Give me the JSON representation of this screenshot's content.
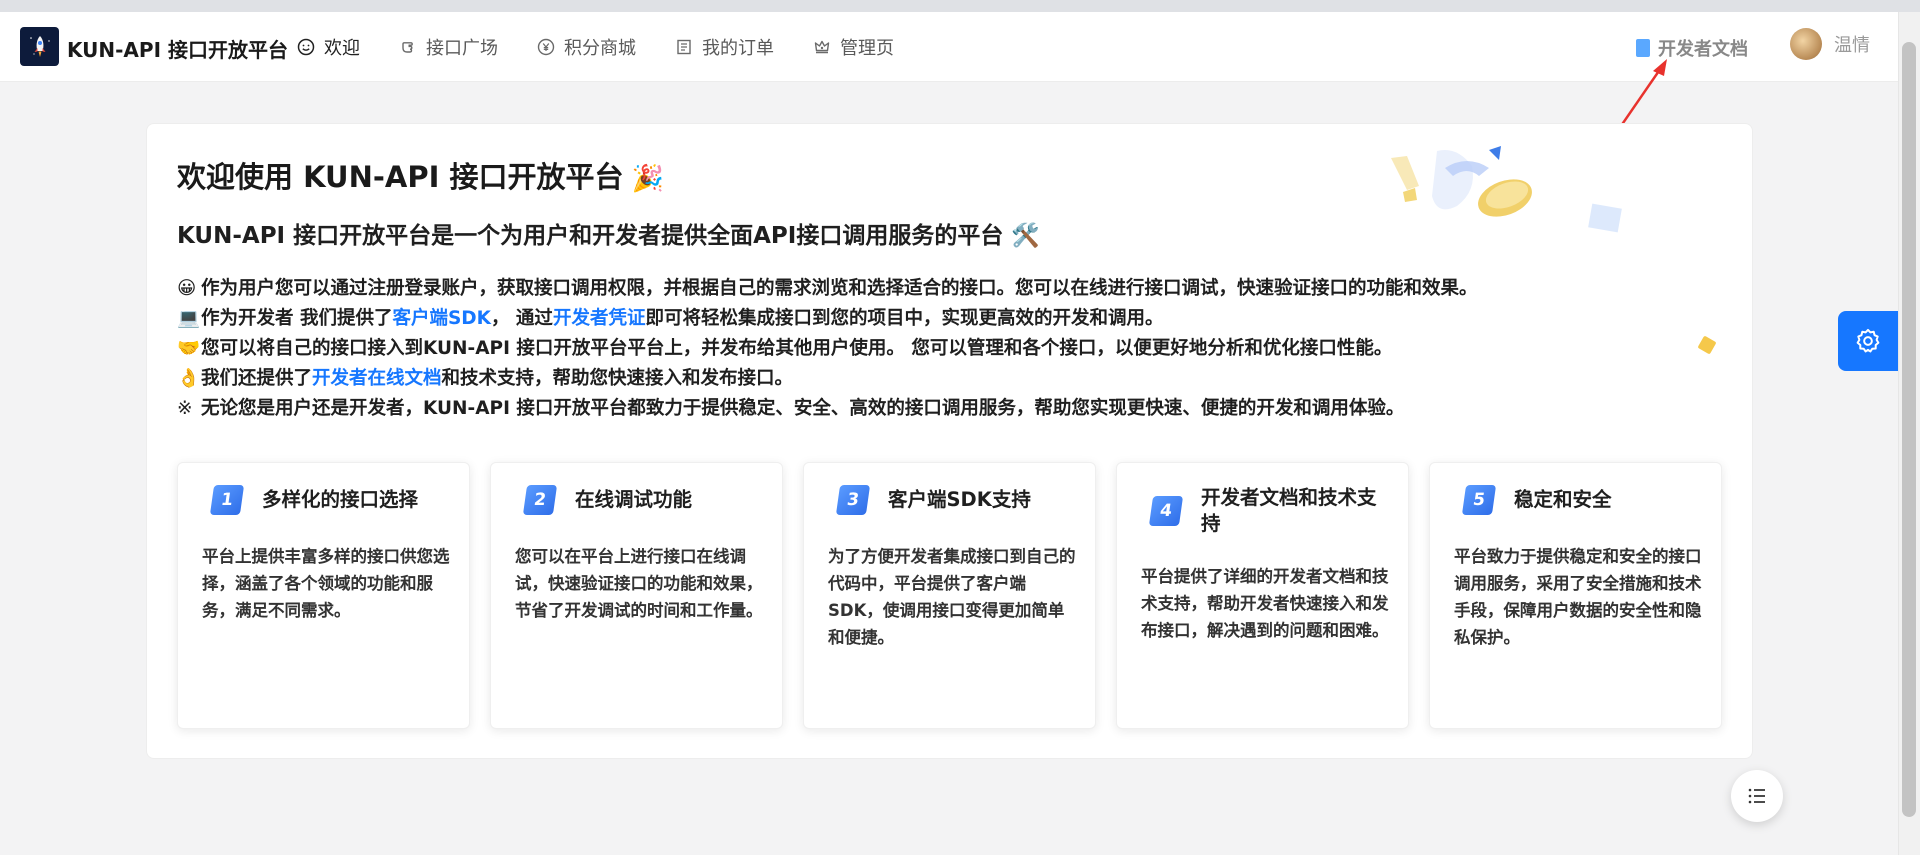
{
  "app": {
    "title": "KUN-API 接口开放平台"
  },
  "nav": [
    {
      "label": "欢迎",
      "icon": "smile-icon",
      "active": true
    },
    {
      "label": "接口广场",
      "icon": "hand-icon",
      "active": false
    },
    {
      "label": "积分商城",
      "icon": "yen-icon",
      "active": false
    },
    {
      "label": "我的订单",
      "icon": "order-list-icon",
      "active": false
    },
    {
      "label": "管理页",
      "icon": "crown-icon",
      "active": false
    }
  ],
  "header": {
    "docs_label": "开发者文档",
    "user_name": "温情"
  },
  "welcome": {
    "title": "欢迎使用 KUN-API 接口开放平台",
    "title_emoji": "🎉",
    "subtitle": "KUN-API 接口开放平台是一个为用户和开发者提供全面API接口调用服务的平台",
    "subtitle_emoji": "🛠️"
  },
  "descriptions": [
    {
      "emoji": "😀",
      "text": "作为用户您可以通过注册登录账户，获取接口调用权限，并根据自己的需求浏览和选择适合的接口。您可以在线进行接口调试，快速验证接口的功能和效果。"
    },
    {
      "emoji": "💻",
      "pre": "作为开发者 我们提供了",
      "link1": "客户端SDK",
      "mid": "， 通过",
      "link2": "开发者凭证",
      "post": "即可将轻松集成接口到您的项目中，实现更高效的开发和调用。"
    },
    {
      "emoji": "🤝",
      "text": "您可以将自己的接口接入到KUN-API 接口开放平台平台上，并发布给其他用户使用。 您可以管理和各个接口，以便更好地分析和优化接口性能。"
    },
    {
      "emoji": "👌",
      "pre": "我们还提供了",
      "link1": "开发者在线文档",
      "post": "和技术支持，帮助您快速接入和发布接口。"
    },
    {
      "emoji": "※",
      "text": "无论您是用户还是开发者，KUN-API 接口开放平台都致力于提供稳定、安全、高效的接口调用服务，帮助您实现更快速、便捷的开发和调用体验。"
    }
  ],
  "features": [
    {
      "num": "1",
      "title": "多样化的接口选择",
      "body": "平台上提供丰富多样的接口供您选择，涵盖了各个领域的功能和服务，满足不同需求。"
    },
    {
      "num": "2",
      "title": "在线调试功能",
      "body": "您可以在平台上进行接口在线调试，快速验证接口的功能和效果，节省了开发调试的时间和工作量。"
    },
    {
      "num": "3",
      "title": "客户端SDK支持",
      "body": "为了方便开发者集成接口到自己的代码中，平台提供了客户端SDK，使调用接口变得更加简单和便捷。"
    },
    {
      "num": "4",
      "title": "开发者文档和技术支持",
      "body": "平台提供了详细的开发者文档和技术支持，帮助开发者快速接入和发布接口，解决遇到的问题和困难。"
    },
    {
      "num": "5",
      "title": "稳定和安全",
      "body": "平台致力于提供稳定和安全的接口调用服务，采用了安全措施和技术手段，保障用户数据的安全性和隐私保护。"
    }
  ],
  "colors": {
    "accent": "#1677ff",
    "annotation_arrow": "#e8322d"
  }
}
